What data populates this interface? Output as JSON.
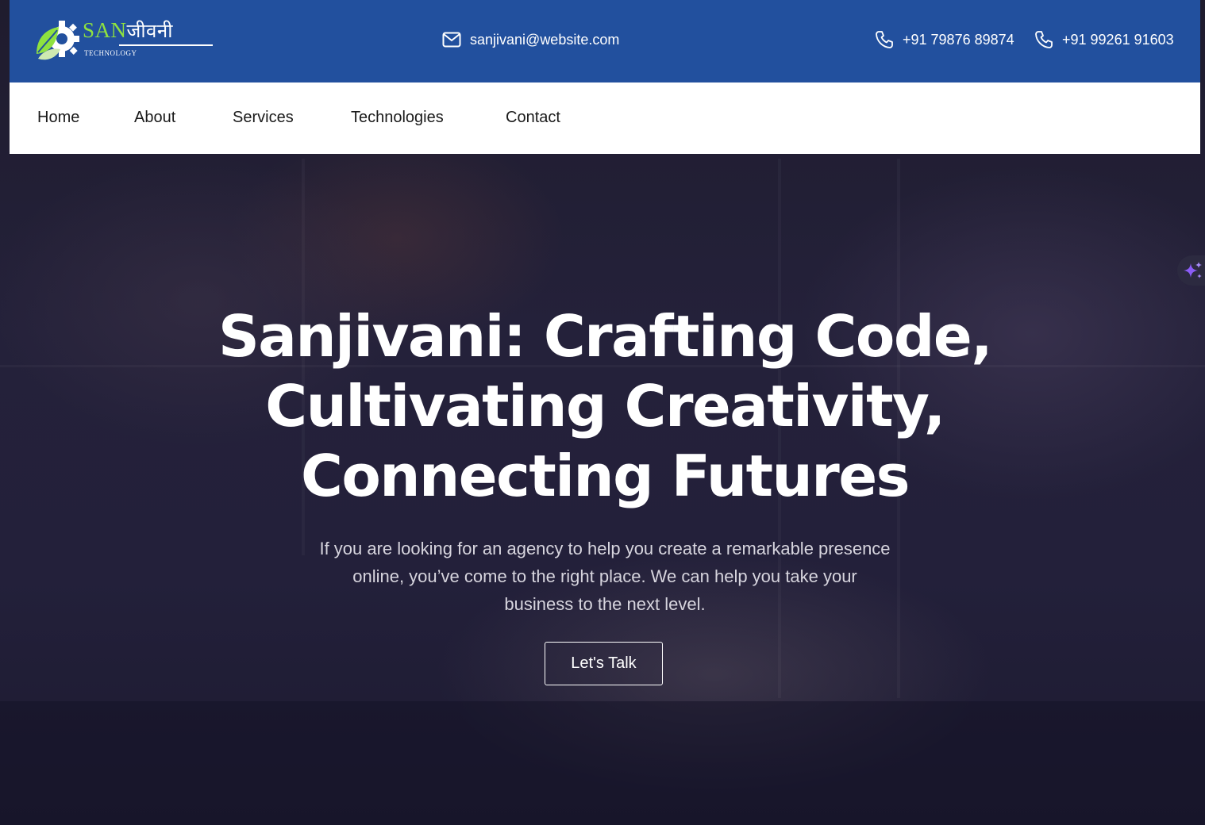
{
  "brand": {
    "logo_primary": "SAN",
    "logo_hindi": "जीवनी",
    "logo_sub": "TECHNOLOGY",
    "color_topbar": "#22509e",
    "color_logo_green": "#8fe23f"
  },
  "topbar": {
    "email": "sanjivani@website.com",
    "phone_1": "+91 79876 89874",
    "phone_2": "+91 99261 91603"
  },
  "nav": {
    "items": [
      {
        "label": "Home"
      },
      {
        "label": "About"
      },
      {
        "label": "Services"
      },
      {
        "label": "Technologies"
      },
      {
        "label": "Contact"
      }
    ]
  },
  "hero": {
    "title_line_1": "Sanjivani: Crafting Code,",
    "title_line_2": "Cultivating Creativity,",
    "title_line_3": "Connecting Futures",
    "subtitle": "If you are looking for an agency to help you create a remarkable presence online, you’ve come to the right place. We can help you take your business to the next level.",
    "cta_label": "Let's Talk"
  },
  "icons": {
    "email": "envelope-icon",
    "phone": "phone-icon",
    "assistant": "sparkle-icon"
  }
}
